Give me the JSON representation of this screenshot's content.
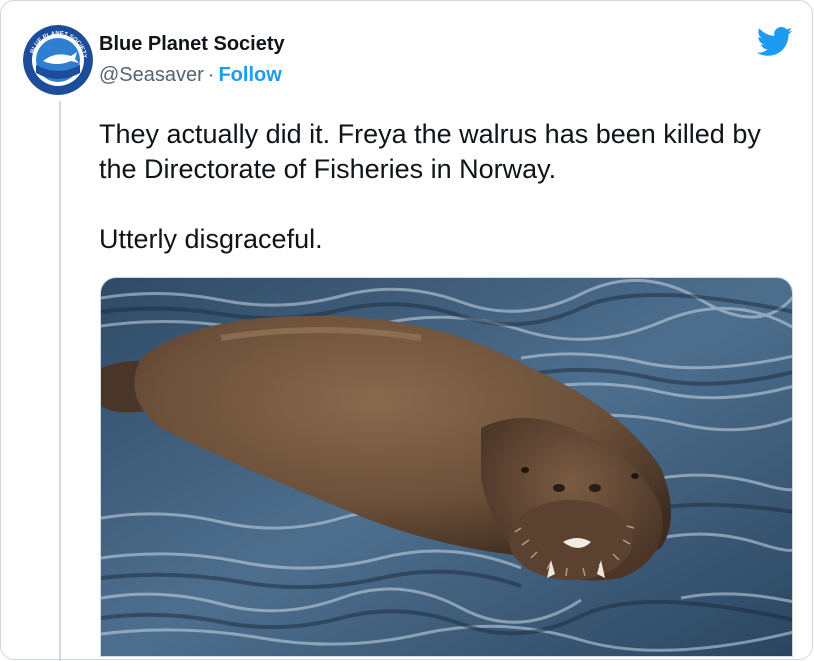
{
  "account": {
    "name": "Blue Planet Society",
    "handle": "@Seasaver",
    "separator": "·",
    "follow_label": "Follow",
    "avatar_text": "BLUE PLANET SOCIETY",
    "brand_color": "#1d9bf0"
  },
  "tweet": {
    "paragraphs": [
      "They actually did it. Freya the walrus has been killed by the Directorate of Fisheries in Norway.",
      "Utterly disgraceful."
    ]
  },
  "icons": {
    "platform": "twitter-bird-icon"
  },
  "media": {
    "type": "photo",
    "subject": "walrus-in-water"
  }
}
